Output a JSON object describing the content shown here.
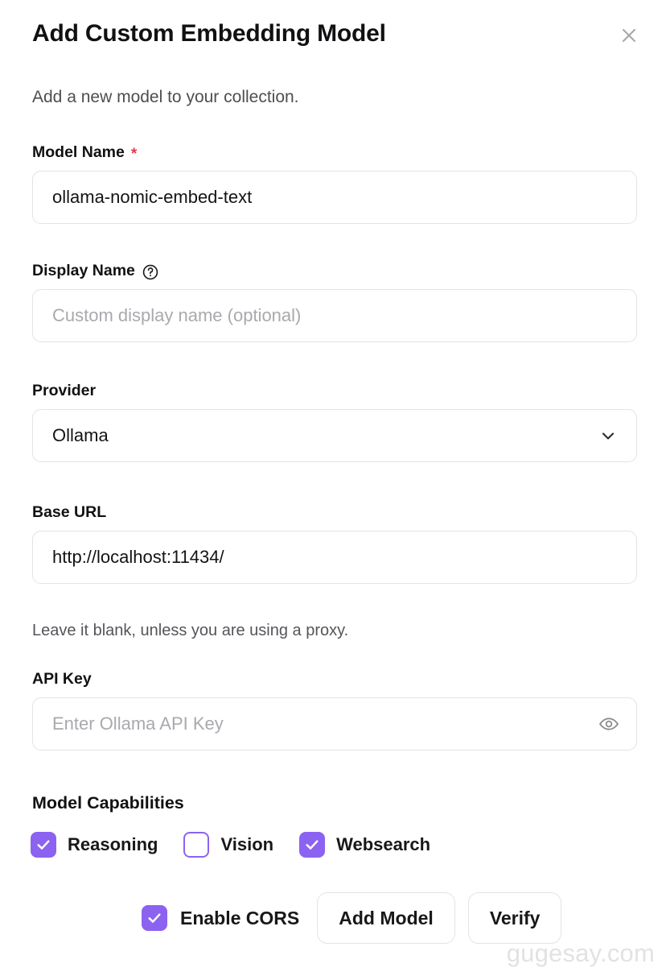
{
  "dialog": {
    "title": "Add Custom Embedding Model",
    "subtitle": "Add a new model to your collection.",
    "close_icon": "close-icon"
  },
  "fields": {
    "model_name": {
      "label": "Model Name",
      "required_marker": "*",
      "value": "ollama-nomic-embed-text",
      "placeholder": ""
    },
    "display_name": {
      "label": "Display Name",
      "help_icon": "help-circle-icon",
      "value": "",
      "placeholder": "Custom display name (optional)"
    },
    "provider": {
      "label": "Provider",
      "value": "Ollama",
      "chevron_icon": "chevron-down-icon",
      "options": [
        "Ollama"
      ]
    },
    "base_url": {
      "label": "Base URL",
      "value": "http://localhost:11434/",
      "placeholder": "",
      "helper": "Leave it blank, unless you are using a proxy."
    },
    "api_key": {
      "label": "API Key",
      "value": "",
      "placeholder": "Enter Ollama API Key",
      "reveal_icon": "eye-icon"
    }
  },
  "capabilities": {
    "title": "Model Capabilities",
    "items": [
      {
        "label": "Reasoning",
        "checked": true
      },
      {
        "label": "Vision",
        "checked": false
      },
      {
        "label": "Websearch",
        "checked": true
      }
    ]
  },
  "footer": {
    "cors": {
      "label": "Enable CORS",
      "checked": true
    },
    "add_model_label": "Add Model",
    "verify_label": "Verify"
  },
  "watermark": "gugesay.com",
  "colors": {
    "accent_purple": "#8b63f0",
    "required_red": "#e8384f",
    "border": "#e3e3e6",
    "text_primary": "#111114",
    "text_muted": "#55555a",
    "placeholder": "#a9a9ae",
    "watermark": "#e2e2e4"
  }
}
